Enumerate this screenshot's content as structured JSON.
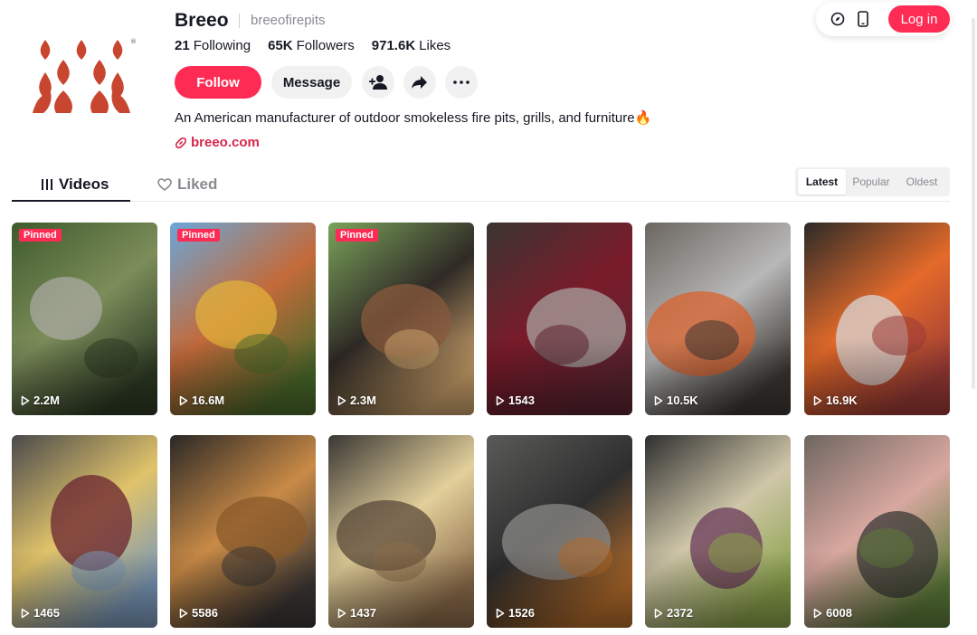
{
  "header": {
    "login_label": "Log in",
    "icons": [
      "compass-icon",
      "phone-icon"
    ]
  },
  "profile": {
    "name": "Breeo",
    "handle": "breeofirepits",
    "stats": {
      "following_num": "21",
      "following_label": "Following",
      "followers_num": "65K",
      "followers_label": "Followers",
      "likes_num": "971.6K",
      "likes_label": "Likes"
    },
    "follow_label": "Follow",
    "message_label": "Message",
    "bio": "An American manufacturer of outdoor smokeless fire pits, grills, and furniture🔥",
    "link": "breeo.com",
    "brand_color": "#c8452f"
  },
  "tabs": {
    "videos_label": "Videos",
    "liked_label": "Liked"
  },
  "sort": {
    "options": [
      "Latest",
      "Popular",
      "Oldest"
    ],
    "active": "Latest"
  },
  "videos": [
    {
      "views": "2.2M",
      "pinned": "Pinned",
      "palette": [
        "#3f5a2c",
        "#7c8d5a",
        "#a9a9a2",
        "#2e3b24"
      ]
    },
    {
      "views": "16.6M",
      "pinned": "Pinned",
      "palette": [
        "#6aa7d8",
        "#c46a3a",
        "#e2b13b",
        "#4a6a2a"
      ]
    },
    {
      "views": "2.3M",
      "pinned": "Pinned",
      "palette": [
        "#7aa35a",
        "#2f2a26",
        "#8a5a3e",
        "#c9a06a"
      ]
    },
    {
      "views": "1543",
      "pinned": "",
      "palette": [
        "#3a3531",
        "#7a1b2a",
        "#a8a4a0",
        "#5b2430"
      ]
    },
    {
      "views": "10.5K",
      "pinned": "",
      "palette": [
        "#6b6660",
        "#b8b8b8",
        "#d9622c",
        "#3b3632"
      ]
    },
    {
      "views": "16.9K",
      "pinned": "",
      "palette": [
        "#2b2a28",
        "#e46a2a",
        "#d8d8d8",
        "#9b3b36"
      ]
    },
    {
      "views": "1465",
      "pinned": "",
      "palette": [
        "#4a4a4c",
        "#e0c36a",
        "#6a2330",
        "#7a98b8"
      ]
    },
    {
      "views": "5586",
      "pinned": "",
      "palette": [
        "#2a2826",
        "#c98a46",
        "#8a5a2a",
        "#3a3634"
      ]
    },
    {
      "views": "1437",
      "pinned": "",
      "palette": [
        "#3a3734",
        "#e2cf9a",
        "#5a4a3a",
        "#8b6b4a"
      ]
    },
    {
      "views": "1526",
      "pinned": "",
      "palette": [
        "#5a5a58",
        "#2e2e2e",
        "#8a8a88",
        "#b06a2a"
      ]
    },
    {
      "views": "2372",
      "pinned": "",
      "palette": [
        "#2f2f30",
        "#cfc6a8",
        "#6a3a5a",
        "#8aa24a"
      ]
    },
    {
      "views": "6008",
      "pinned": "",
      "palette": [
        "#6e6660",
        "#d8a8a0",
        "#3a3836",
        "#5c7a3a"
      ]
    }
  ]
}
